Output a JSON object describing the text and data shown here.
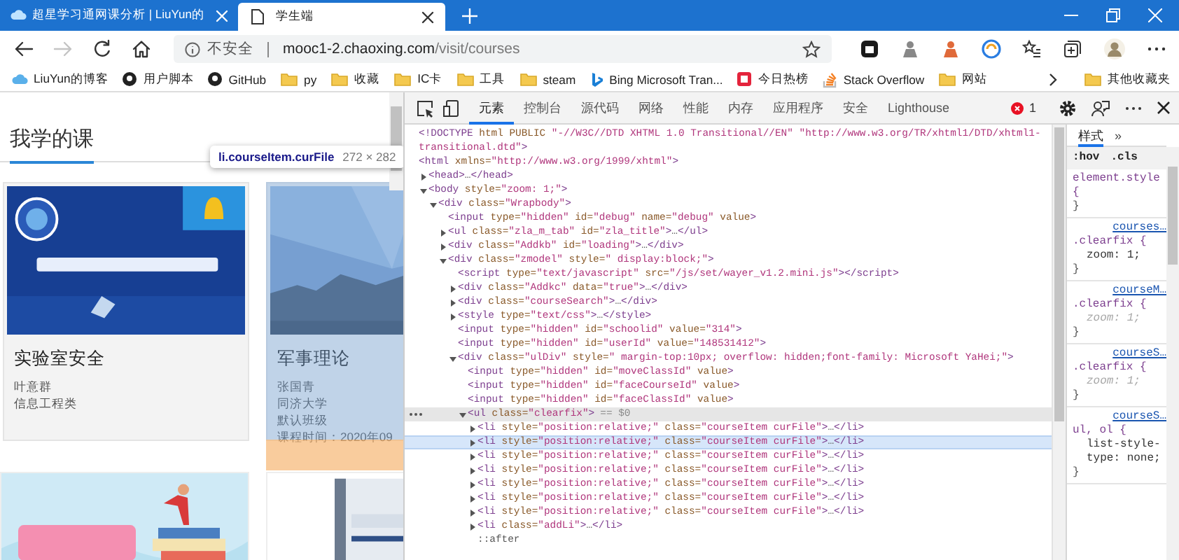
{
  "browser_tabs": [
    {
      "title": "超星学习通网课分析 | LiuYun的",
      "selected": false
    },
    {
      "title": "学生端",
      "selected": true
    }
  ],
  "address_bar": {
    "security": "不安全",
    "host": "mooc1-2.chaoxing.com",
    "path": "/visit/courses"
  },
  "bookmarks": [
    {
      "label": "LiuYun的博客"
    },
    {
      "label": "用户脚本"
    },
    {
      "label": "GitHub"
    },
    {
      "label": "py"
    },
    {
      "label": "收藏"
    },
    {
      "label": "IC卡"
    },
    {
      "label": "工具"
    },
    {
      "label": "steam"
    },
    {
      "label": "Bing Microsoft Tran..."
    },
    {
      "label": "今日热榜"
    },
    {
      "label": "Stack Overflow"
    },
    {
      "label": "网站"
    }
  ],
  "other_bookmarks": {
    "label": "其他收藏夹"
  },
  "page": {
    "heading": "我学的课",
    "courses": [
      {
        "title": "实验室安全",
        "lines": [
          "叶意群",
          "信息工程类"
        ],
        "highlighted": false
      },
      {
        "title": "军事理论",
        "lines": [
          "张国青",
          "同济大学",
          "默认班级",
          "课程时间：2020年09"
        ],
        "highlighted": true
      }
    ]
  },
  "inspect_tooltip": {
    "selector": "li.courseItem.curFile",
    "size": "272 × 282"
  },
  "devtools": {
    "tabs": [
      {
        "label": "元素",
        "selected": true
      },
      {
        "label": "控制台",
        "selected": false
      },
      {
        "label": "源代码",
        "selected": false
      },
      {
        "label": "网络",
        "selected": false
      },
      {
        "label": "性能",
        "selected": false
      },
      {
        "label": "内存",
        "selected": false
      },
      {
        "label": "应用程序",
        "selected": false
      },
      {
        "label": "安全",
        "selected": false
      },
      {
        "label": "Lighthouse",
        "selected": false
      }
    ],
    "error_count": "1",
    "dom_tree": [
      {
        "text": "<!DOCTYPE html PUBLIC \"-//W3C//DTD XHTML 1.0 Transitional//EN\" \"http://www.w3.org/TR/xhtml1/DTD/xhtml1-transitional.dtd\">",
        "selected": false,
        "hovered": false
      },
      {
        "text": "<html xmlns=\"http://www.w3.org/1999/xhtml\">",
        "selected": false,
        "hovered": false,
        "children": [
          {
            "text": "<head>…</head>",
            "expanded": false,
            "selected": false,
            "hovered": false
          },
          {
            "text": "<body style=\"zoom: 1;\">",
            "expanded": true,
            "selected": false,
            "hovered": false,
            "children": [
              {
                "text": "<div class=\"Wrapbody\">",
                "expanded": true,
                "selected": false,
                "hovered": false,
                "children": [
                  {
                    "text": "<input type=\"hidden\" id=\"debug\" name=\"debug\" value>",
                    "selected": false,
                    "hovered": false
                  },
                  {
                    "text": "<ul class=\"zla_m_tab\" id=\"zla_title\">…</ul>",
                    "expanded": false,
                    "selected": false,
                    "hovered": false
                  },
                  {
                    "text": "<div class=\"Addkb\" id=\"loading\">…</div>",
                    "expanded": false,
                    "selected": false,
                    "hovered": false
                  },
                  {
                    "text": "<div class=\"zmodel\" style=\" display:block;\">",
                    "expanded": true,
                    "selected": false,
                    "hovered": false,
                    "children": [
                      {
                        "text": "<script type=\"text/javascript\" src=\"/js/set/wayer_v1.2.mini.js\"></script>",
                        "selected": false,
                        "hovered": false
                      },
                      {
                        "text": "<div class=\"Addkc\" data=\"true\">…</div>",
                        "expanded": false,
                        "selected": false,
                        "hovered": false
                      },
                      {
                        "text": "<div class=\"courseSearch\">…</div>",
                        "expanded": false,
                        "selected": false,
                        "hovered": false
                      },
                      {
                        "text": "<style type=\"text/css\">…</style>",
                        "expanded": false,
                        "selected": false,
                        "hovered": false
                      },
                      {
                        "text": "<input type=\"hidden\" id=\"schoolid\" value=\"314\">",
                        "selected": false,
                        "hovered": false
                      },
                      {
                        "text": "<input type=\"hidden\" id=\"userId\" value=\"148531412\">",
                        "selected": false,
                        "hovered": false
                      },
                      {
                        "text": "<div class=\"ulDiv\" style=\" margin-top:10px;  overflow: hidden;font-family: Microsoft YaHei;\">",
                        "expanded": true,
                        "selected": false,
                        "hovered": false,
                        "children": [
                          {
                            "text": "<input type=\"hidden\" id=\"moveClassId\" value>",
                            "selected": false,
                            "hovered": false
                          },
                          {
                            "text": "<input type=\"hidden\" id=\"faceCourseId\" value>",
                            "selected": false,
                            "hovered": false
                          },
                          {
                            "text": "<input type=\"hidden\" id=\"faceClassId\" value>",
                            "selected": false,
                            "hovered": false
                          },
                          {
                            "text": "<ul class=\"clearfix\">",
                            "expanded": true,
                            "selected": true,
                            "hovered": false,
                            "console_ref": "== $0",
                            "children": [
                              {
                                "text": "<li style=\"position:relative;\" class=\"courseItem curFile\">…</li>",
                                "expanded": false,
                                "selected": false,
                                "hovered": false
                              },
                              {
                                "text": "<li style=\"position:relative;\" class=\"courseItem curFile\">…</li>",
                                "expanded": false,
                                "selected": false,
                                "hovered": true
                              },
                              {
                                "text": "<li style=\"position:relative;\" class=\"courseItem curFile\">…</li>",
                                "expanded": false,
                                "selected": false,
                                "hovered": false
                              },
                              {
                                "text": "<li style=\"position:relative;\" class=\"courseItem curFile\">…</li>",
                                "expanded": false,
                                "selected": false,
                                "hovered": false
                              },
                              {
                                "text": "<li style=\"position:relative;\" class=\"courseItem curFile\">…</li>",
                                "expanded": false,
                                "selected": false,
                                "hovered": false
                              },
                              {
                                "text": "<li style=\"position:relative;\" class=\"courseItem curFile\">…</li>",
                                "expanded": false,
                                "selected": false,
                                "hovered": false
                              },
                              {
                                "text": "<li style=\"position:relative;\" class=\"courseItem curFile\">…</li>",
                                "expanded": false,
                                "selected": false,
                                "hovered": false
                              },
                              {
                                "text": "<li class=\"addLi\">…</li>",
                                "expanded": false,
                                "selected": false,
                                "hovered": false
                              },
                              {
                                "text": "::after",
                                "selected": false,
                                "hovered": false
                              }
                            ]
                          }
                        ]
                      }
                    ]
                  }
                ]
              }
            ]
          }
        ]
      }
    ],
    "styles_tabs": [
      {
        "label": "样式",
        "selected": true
      }
    ],
    "styles_more": "»",
    "filters": [
      ":hov",
      ".cls"
    ],
    "rules": [
      {
        "selector": "element.style {",
        "close": "}"
      },
      {
        "source": "courses…",
        "selector": ".clearfix {",
        "declarations": [
          {
            "name": "zoom:",
            "value": "1;",
            "overridden": false
          }
        ],
        "close": "}"
      },
      {
        "source": "courseM…",
        "selector": ".clearfix {",
        "declarations": [
          {
            "name": "zoom:",
            "value": "1;",
            "overridden": true
          }
        ],
        "close": "}"
      },
      {
        "source": "courseS…",
        "selector": ".clearfix {",
        "declarations": [
          {
            "name": "zoom:",
            "value": "1;",
            "overridden": true
          }
        ],
        "close": "}"
      },
      {
        "source": "courseS…",
        "selector": "ul, ol {",
        "declarations": [
          {
            "name": "list-style-type:",
            "value": "none;",
            "overridden": false
          }
        ],
        "close": "}"
      }
    ]
  }
}
